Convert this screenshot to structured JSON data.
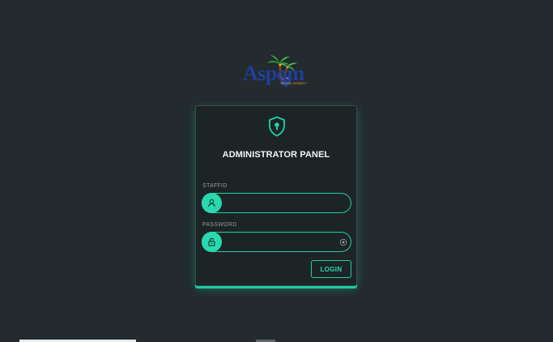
{
  "logo": {
    "text": "Aspom",
    "tagline": "TRAVEL AGENCY"
  },
  "panel": {
    "title": "ADMINISTRATOR PANEL"
  },
  "form": {
    "staffid": {
      "label": "STAFFID",
      "value": "",
      "icon": "user-icon"
    },
    "password": {
      "label": "PASSWORD",
      "value": "",
      "icon": "lock-icon",
      "toggle_icon": "eye-icon"
    },
    "login_label": "LOGIN"
  },
  "colors": {
    "background": "#232b2f",
    "card": "#1d2426",
    "accent": "#1fd1a4",
    "logo_blue": "#1f3f9a"
  }
}
